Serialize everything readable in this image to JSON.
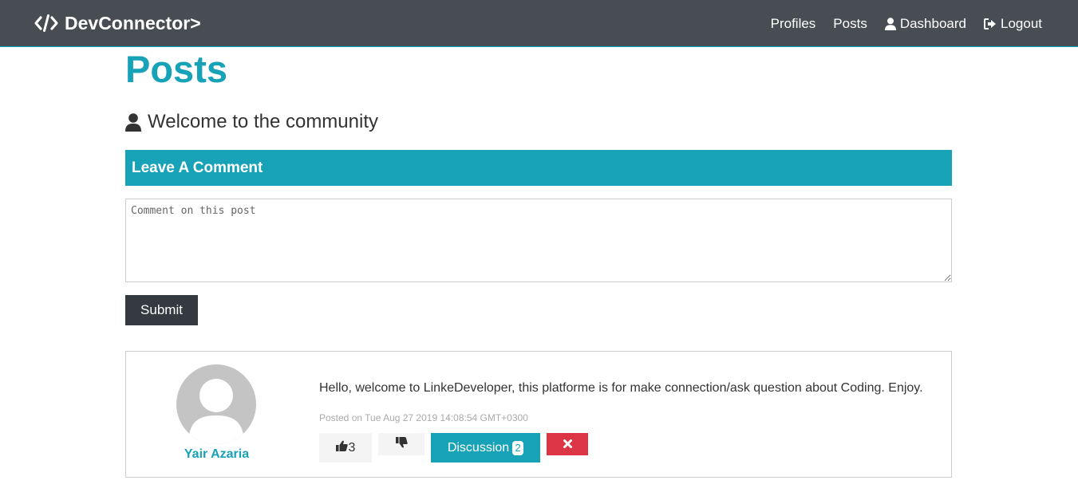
{
  "navbar": {
    "brand": "DevConnector>",
    "links": [
      {
        "label": "Profiles"
      },
      {
        "label": "Posts"
      },
      {
        "label": "Dashboard",
        "icon": "user-icon"
      },
      {
        "label": "Logout",
        "icon": "sign-out-icon"
      }
    ]
  },
  "page": {
    "title": "Posts",
    "lead": "Welcome to the community"
  },
  "comment_form": {
    "header": "Leave A Comment",
    "placeholder": "Comment on this post",
    "value": "",
    "submit_label": "Submit"
  },
  "post": {
    "author": "Yair Azaria",
    "text": "Hello, welcome to LinkeDeveloper, this platforme is for make connection/ask question about Coding. Enjoy.",
    "date": "Posted on Tue Aug 27 2019 14:08:54 GMT+0300",
    "likes": "3",
    "discussion_label": "Discussion",
    "comment_count": "2"
  },
  "colors": {
    "primary": "#17a2b8",
    "dark": "#343a40",
    "navbar": "#484d54",
    "danger": "#dc3545",
    "light": "#f4f4f4"
  }
}
